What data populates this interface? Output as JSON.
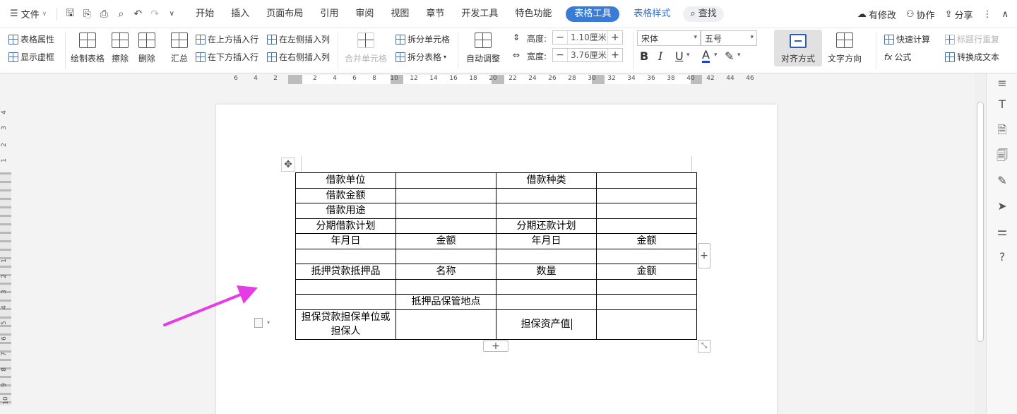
{
  "menubar": {
    "file_label": "文件",
    "tabs": [
      "开始",
      "插入",
      "页面布局",
      "引用",
      "审阅",
      "视图",
      "章节",
      "开发工具",
      "特色功能"
    ],
    "active_tab": "表格工具",
    "blue_tab": "表格样式",
    "search_label": "查找",
    "right": {
      "modified": "有修改",
      "collab": "协作",
      "share": "分享"
    }
  },
  "ribbon": {
    "table_props": "表格属性",
    "show_grid": "显示虚框",
    "draw_table": "绘制表格",
    "erase": "擦除",
    "delete": "删除",
    "summary": "汇总",
    "insert_above": "在上方插入行",
    "insert_below": "在下方插入行",
    "insert_left": "在左侧插入列",
    "insert_right": "在右侧插入列",
    "merge_cells": "合并单元格",
    "split_cells": "拆分单元格",
    "split_table": "拆分表格",
    "auto_fit": "自动调整",
    "height_label": "高度:",
    "height_value": "1.10厘米",
    "width_label": "宽度:",
    "width_value": "3.76厘米",
    "font_name": "宋体",
    "font_size": "五号",
    "bold": "B",
    "italic": "I",
    "underline": "U",
    "font_color": "A",
    "align": "对齐方式",
    "text_direction": "文字方向",
    "quick_calc": "快速计算",
    "formula": "公式",
    "repeat_header": "标题行重复",
    "to_text": "转换成文本"
  },
  "ruler": {
    "ticks": [
      "6",
      "4",
      "2",
      "2",
      "4",
      "6",
      "8",
      "10",
      "12",
      "14",
      "16",
      "18",
      "20",
      "22",
      "24",
      "26",
      "28",
      "30",
      "32",
      "34",
      "36",
      "38",
      "40",
      "42",
      "44",
      "46"
    ],
    "vticks": [
      "4",
      "3",
      "2",
      "1",
      "1",
      "2",
      "3",
      "4",
      "5",
      "6",
      "7",
      "8",
      "9",
      "10",
      "11",
      "12",
      "13",
      "14",
      "15",
      "16"
    ]
  },
  "table": {
    "rows": [
      [
        "借款单位",
        "",
        "借款种类",
        ""
      ],
      [
        "借款金额",
        "",
        "",
        ""
      ],
      [
        "借款用途",
        "",
        "",
        ""
      ],
      [
        "分期借款计划",
        "",
        "分期还款计划",
        ""
      ],
      [
        "年月日",
        "金额",
        "年月日",
        "金额"
      ],
      [
        "",
        "",
        "",
        ""
      ],
      [
        "抵押贷款抵押品",
        "名称",
        "数量",
        "金额"
      ],
      [
        "",
        "",
        "",
        ""
      ],
      [
        "",
        "抵押品保管地点",
        "",
        ""
      ],
      [
        "担保贷款担保单位或担保人",
        "",
        "担保资产值",
        ""
      ]
    ]
  },
  "colors": {
    "accent": "#3a7bd5",
    "arrow": "#e63ce6"
  },
  "icons": [
    "move-icon",
    "add-row-icon",
    "add-column-icon",
    "resize-icon",
    "document-icon"
  ]
}
